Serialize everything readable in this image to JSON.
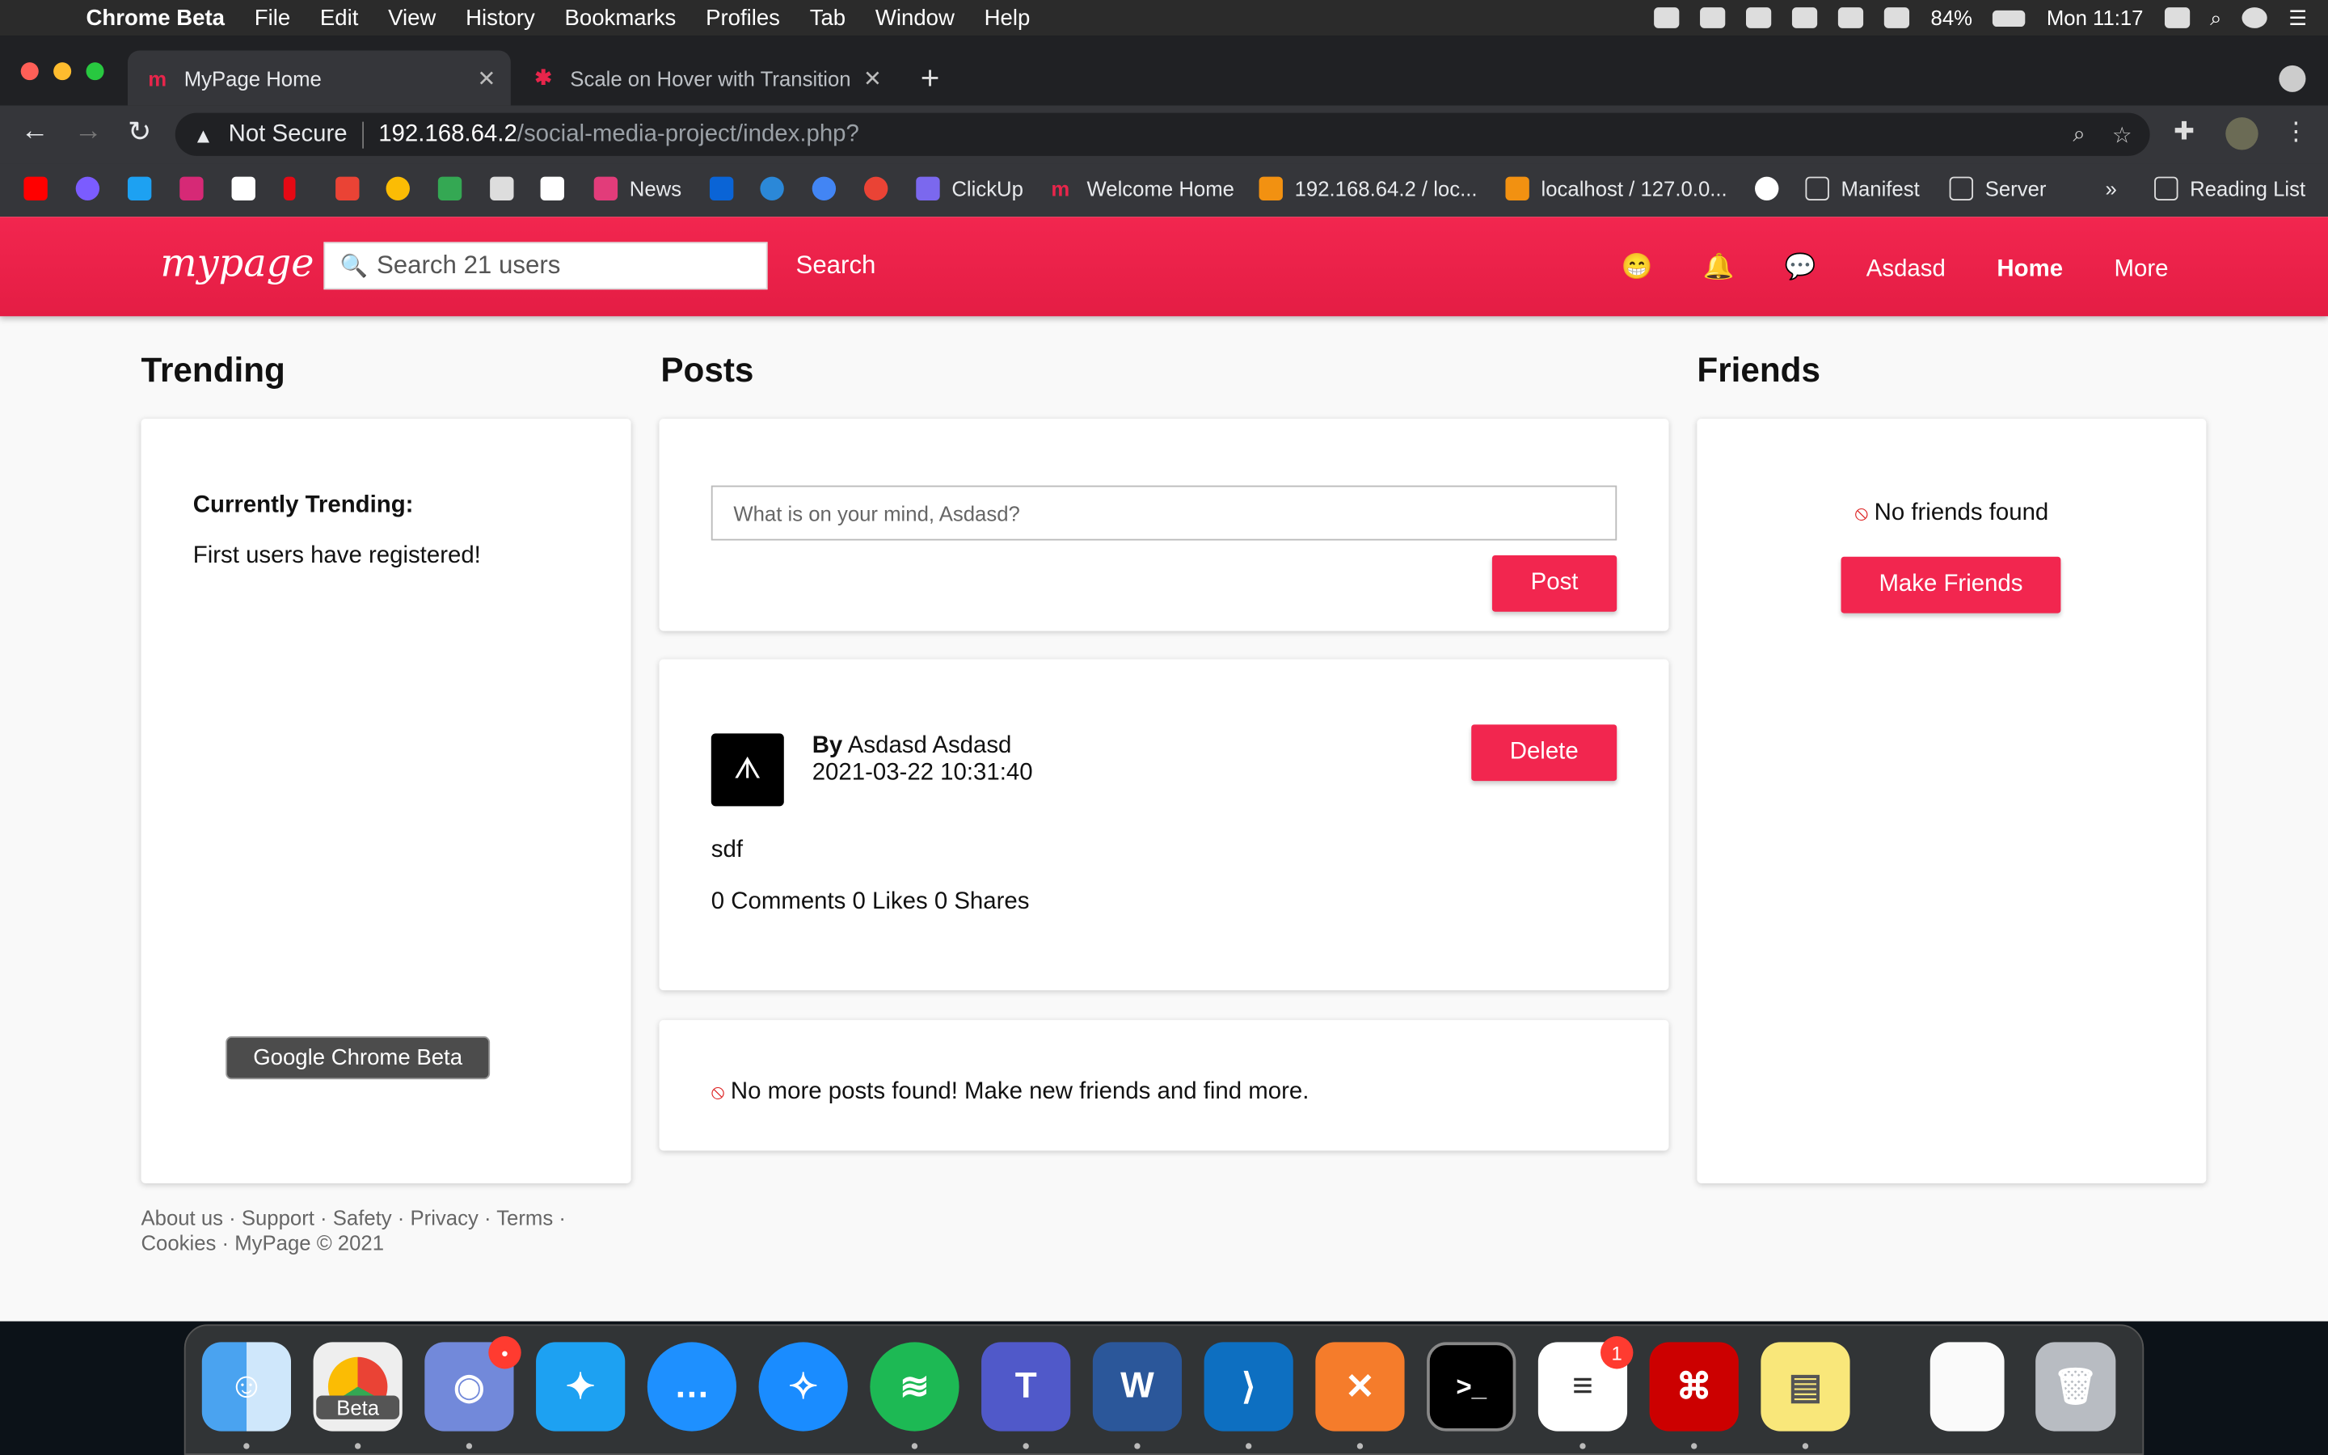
{
  "menubar": {
    "app": "Chrome Beta",
    "items": [
      "File",
      "Edit",
      "View",
      "History",
      "Bookmarks",
      "Profiles",
      "Tab",
      "Window",
      "Help"
    ],
    "battery": "84%",
    "clock": "Mon 11:17"
  },
  "tabs": [
    {
      "title": "MyPage Home",
      "active": true
    },
    {
      "title": "Scale on Hover with Transition",
      "active": false
    }
  ],
  "omnibox": {
    "security": "Not Secure",
    "host": "192.168.64.2",
    "path": "/social-media-project/index.php?"
  },
  "bookmarks": {
    "news": "News",
    "clickup": "ClickUp",
    "welcome": "Welcome Home",
    "pma1": "192.168.64.2 / loc...",
    "pma2": "localhost / 127.0.0...",
    "manifest": "Manifest",
    "server": "Server",
    "overflow": "»",
    "reading_list": "Reading List"
  },
  "site": {
    "logo": "mypage",
    "search_placeholder": "Search 21 users",
    "search_button": "Search",
    "nav": {
      "user": "Asdasd",
      "home": "Home",
      "more": "More"
    },
    "icons": {
      "emoji": "😁",
      "bell": "🔔",
      "chat": "💬"
    }
  },
  "trending": {
    "heading": "Trending",
    "label": "Currently Trending:",
    "text": "First users have registered!"
  },
  "posts": {
    "heading": "Posts",
    "composer_placeholder": "What is on your mind, Asdasd?",
    "post_button": "Post",
    "items": [
      {
        "by_label": "By",
        "author": "Asdasd Asdasd",
        "timestamp": "2021-03-22 10:31:40",
        "delete_button": "Delete",
        "body": "sdf",
        "stats": "0 Comments 0 Likes 0 Shares"
      }
    ],
    "no_more": "No more posts found! Make new friends and find more."
  },
  "friends": {
    "heading": "Friends",
    "empty": "No friends found",
    "make_button": "Make Friends"
  },
  "footer": {
    "line1": "About us · Support · Safety · Privacy · Terms ·",
    "line2": "Cookies · MyPage © 2021"
  },
  "tooltip": "Google Chrome Beta",
  "dock": {
    "beta_label": "Beta",
    "discord_badge": "•",
    "reminders_badge": "1",
    "apps": [
      "Finder",
      "Google Chrome Beta",
      "Discord",
      "Twitter",
      "Messages",
      "Safari",
      "Spotify",
      "Teams",
      "Word",
      "Visual Studio Code",
      "XAMPP",
      "Terminal",
      "Reminders",
      "Acrobat",
      "Stickies",
      "Document",
      "Trash"
    ]
  },
  "colors": {
    "brand": "#f2264f",
    "page_bg": "#f9f9f9"
  }
}
